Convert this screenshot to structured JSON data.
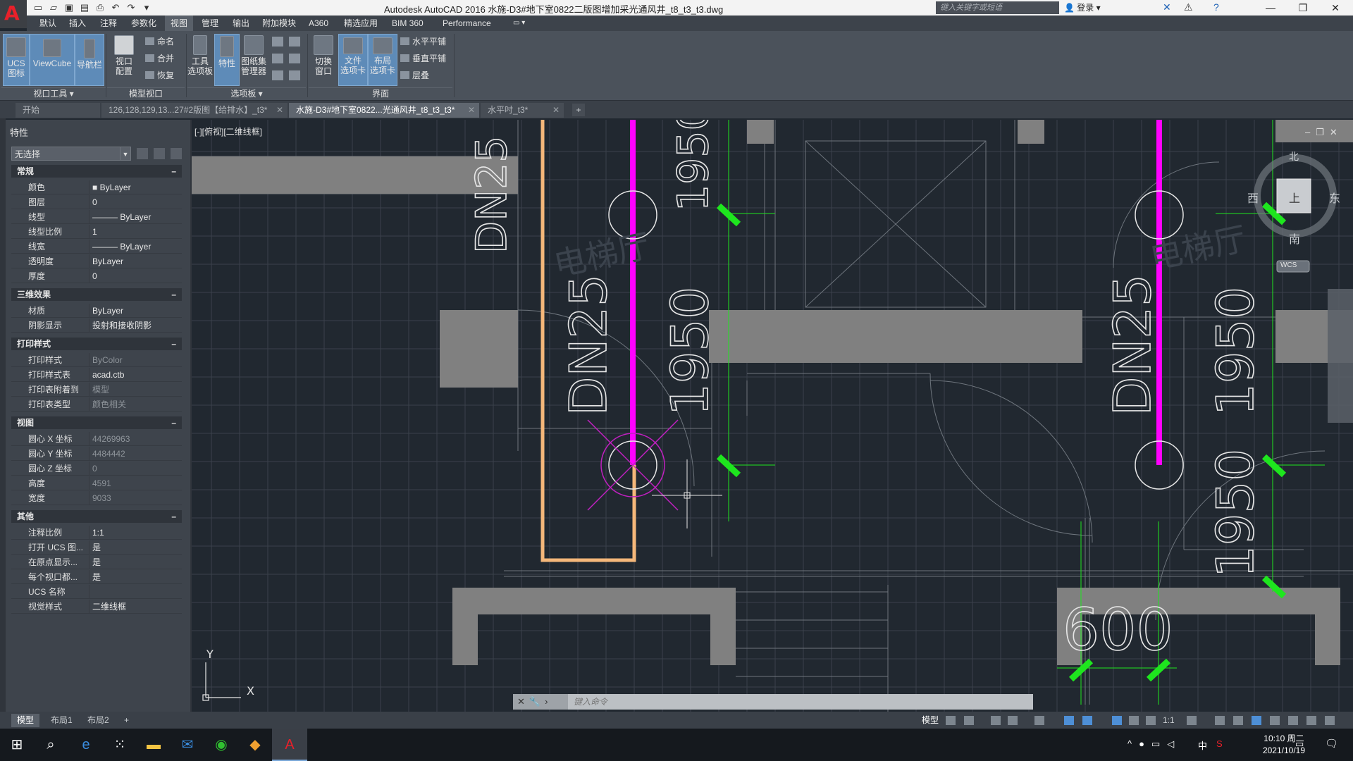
{
  "window": {
    "title": "Autodesk AutoCAD 2016    水施-D3#地下室0822二版图增加采光通风井_t8_t3_t3.dwg",
    "search_placeholder": "键入关键字或短语",
    "login": "登录"
  },
  "menu_tabs": [
    "默认",
    "插入",
    "注释",
    "参数化",
    "视图",
    "管理",
    "输出",
    "附加模块",
    "A360",
    "精选应用",
    "BIM 360",
    "Performance"
  ],
  "active_menu_tab": "视图",
  "ribbon": {
    "ucs_icon": "UCS\n图标",
    "viewcube": "ViewCube",
    "navbar": "导航栏",
    "viewport_config": "视口\n配置",
    "named": "命名",
    "merge": "合并",
    "restore": "恢复",
    "tool_palettes": "工具\n选项板",
    "properties": "特性",
    "sheetset": "图纸集\n管理器",
    "switch_window": "切换\n窗口",
    "file_tabs": "文件\n选项卡",
    "layout_tabs": "布局\n选项卡",
    "tile_h": "水平平铺",
    "tile_v": "垂直平铺",
    "cascade": "层叠",
    "panels": [
      "视口工具 ▾",
      "模型视口",
      "选项板 ▾",
      "界面"
    ]
  },
  "doc_tabs": [
    {
      "label": "开始",
      "active": false
    },
    {
      "label": "126,128,129,13...27#2版图【给排水】_t3*",
      "active": false
    },
    {
      "label": "水施-D3#地下室0822...光通风井_t8_t3_t3*",
      "active": true
    },
    {
      "label": "水平吋_t3*",
      "active": false
    }
  ],
  "properties": {
    "title": "特性",
    "selection": "无选择",
    "sections": [
      {
        "name": "常规",
        "rows": [
          [
            "颜色",
            "■ ByLayer",
            false
          ],
          [
            "图层",
            "0",
            false
          ],
          [
            "线型",
            "——— ByLayer",
            false
          ],
          [
            "线型比例",
            "1",
            false
          ],
          [
            "线宽",
            "——— ByLayer",
            false
          ],
          [
            "透明度",
            "ByLayer",
            false
          ],
          [
            "厚度",
            "0",
            false
          ]
        ]
      },
      {
        "name": "三维效果",
        "rows": [
          [
            "材质",
            "ByLayer",
            false
          ],
          [
            "阴影显示",
            "投射和接收阴影",
            false
          ]
        ]
      },
      {
        "name": "打印样式",
        "rows": [
          [
            "打印样式",
            "ByColor",
            true
          ],
          [
            "打印样式表",
            "acad.ctb",
            false
          ],
          [
            "打印表附着到",
            "模型",
            true
          ],
          [
            "打印表类型",
            "颜色相关",
            true
          ]
        ]
      },
      {
        "name": "视图",
        "rows": [
          [
            "圆心 X 坐标",
            "44269963",
            true
          ],
          [
            "圆心 Y 坐标",
            "4484442",
            true
          ],
          [
            "圆心 Z 坐标",
            "0",
            true
          ],
          [
            "高度",
            "4591",
            true
          ],
          [
            "宽度",
            "9033",
            true
          ]
        ]
      },
      {
        "name": "其他",
        "rows": [
          [
            "注释比例",
            "1:1",
            false
          ],
          [
            "打开 UCS 图...",
            "是",
            false
          ],
          [
            "在原点显示...",
            "是",
            false
          ],
          [
            "每个视口都...",
            "是",
            false
          ],
          [
            "UCS 名称",
            "",
            false
          ],
          [
            "视觉样式",
            "二维线框",
            false
          ]
        ]
      }
    ]
  },
  "drawing": {
    "view_label": "[-][俯视][二维线框]",
    "texts": [
      "DN25",
      "DN25",
      "1950",
      "1950",
      "1950",
      "600",
      "电梯厅",
      "电梯厅"
    ],
    "viewcube": {
      "north": "北",
      "south": "南",
      "east": "东",
      "west": "西",
      "top": "上",
      "wcs": "WCS"
    },
    "axis_x": "X",
    "axis_y": "Y",
    "colors": {
      "pipe_magenta": "#ff00ff",
      "pipe_orange": "#f5b77a",
      "green": "#1ee61e",
      "wall": "#808080"
    }
  },
  "command": {
    "placeholder": "键入命令"
  },
  "layout_tabs": [
    "模型",
    "布局1",
    "布局2"
  ],
  "status": {
    "model": "模型",
    "scale": "1:1"
  },
  "taskbar": {
    "time": "10:10 周二",
    "date": "2021/10/19",
    "ime": "中"
  }
}
